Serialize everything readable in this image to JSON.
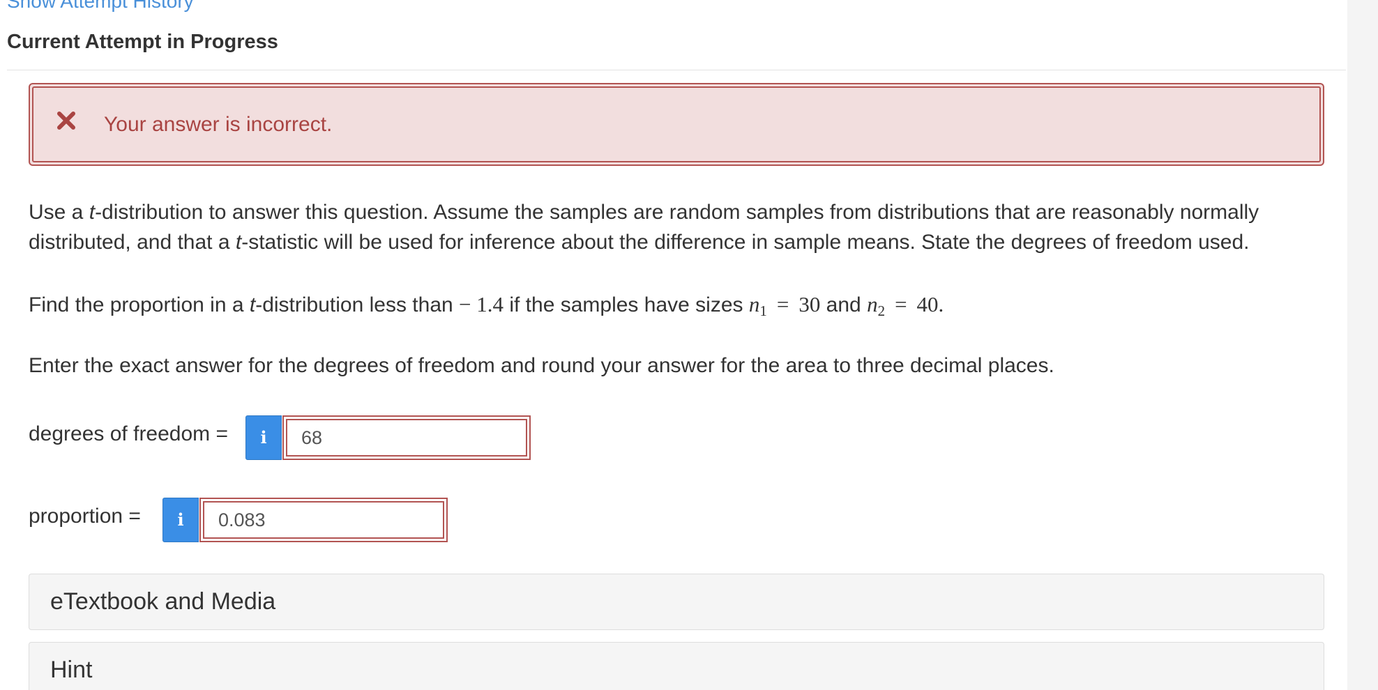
{
  "header": {
    "attempt_history_link": "Show Attempt History",
    "current_attempt_heading": "Current Attempt in Progress"
  },
  "alert": {
    "icon": "close-x-icon",
    "message": "Your answer is incorrect.",
    "color": "#a94442",
    "background": "#f2dede"
  },
  "question": {
    "p1_a": "Use a ",
    "p1_t": "t",
    "p1_b": "-distribution to answer this question. Assume the samples are random samples from distributions that are reasonably normally distributed, and that a ",
    "p1_t2": "t",
    "p1_c": "-statistic will be used for inference about the difference in sample means. State the degrees of freedom used.",
    "p2_a": "Find the proportion in a ",
    "p2_t": "t",
    "p2_b": "-distribution less than ",
    "p2_value": "− 1.4",
    "p2_c": " if the samples have sizes ",
    "n_symbol": "n",
    "n1_sub": "1",
    "equals": "=",
    "n1_value": "30",
    "p2_and": " and ",
    "n2_sub": "2",
    "n2_value": "40.",
    "p3": "Enter the exact answer for the degrees of freedom and round your answer for the area to three decimal places."
  },
  "answers": {
    "dof_label": "degrees of freedom =",
    "dof_value": "68",
    "proportion_label": "proportion =",
    "proportion_value": "0.083",
    "info_icon": "info-icon",
    "info_glyph": "i",
    "info_color": "#3a8ee6",
    "error_border_color": "#b25452"
  },
  "panels": {
    "etextbook_label": "eTextbook and Media",
    "hint_label": "Hint"
  }
}
